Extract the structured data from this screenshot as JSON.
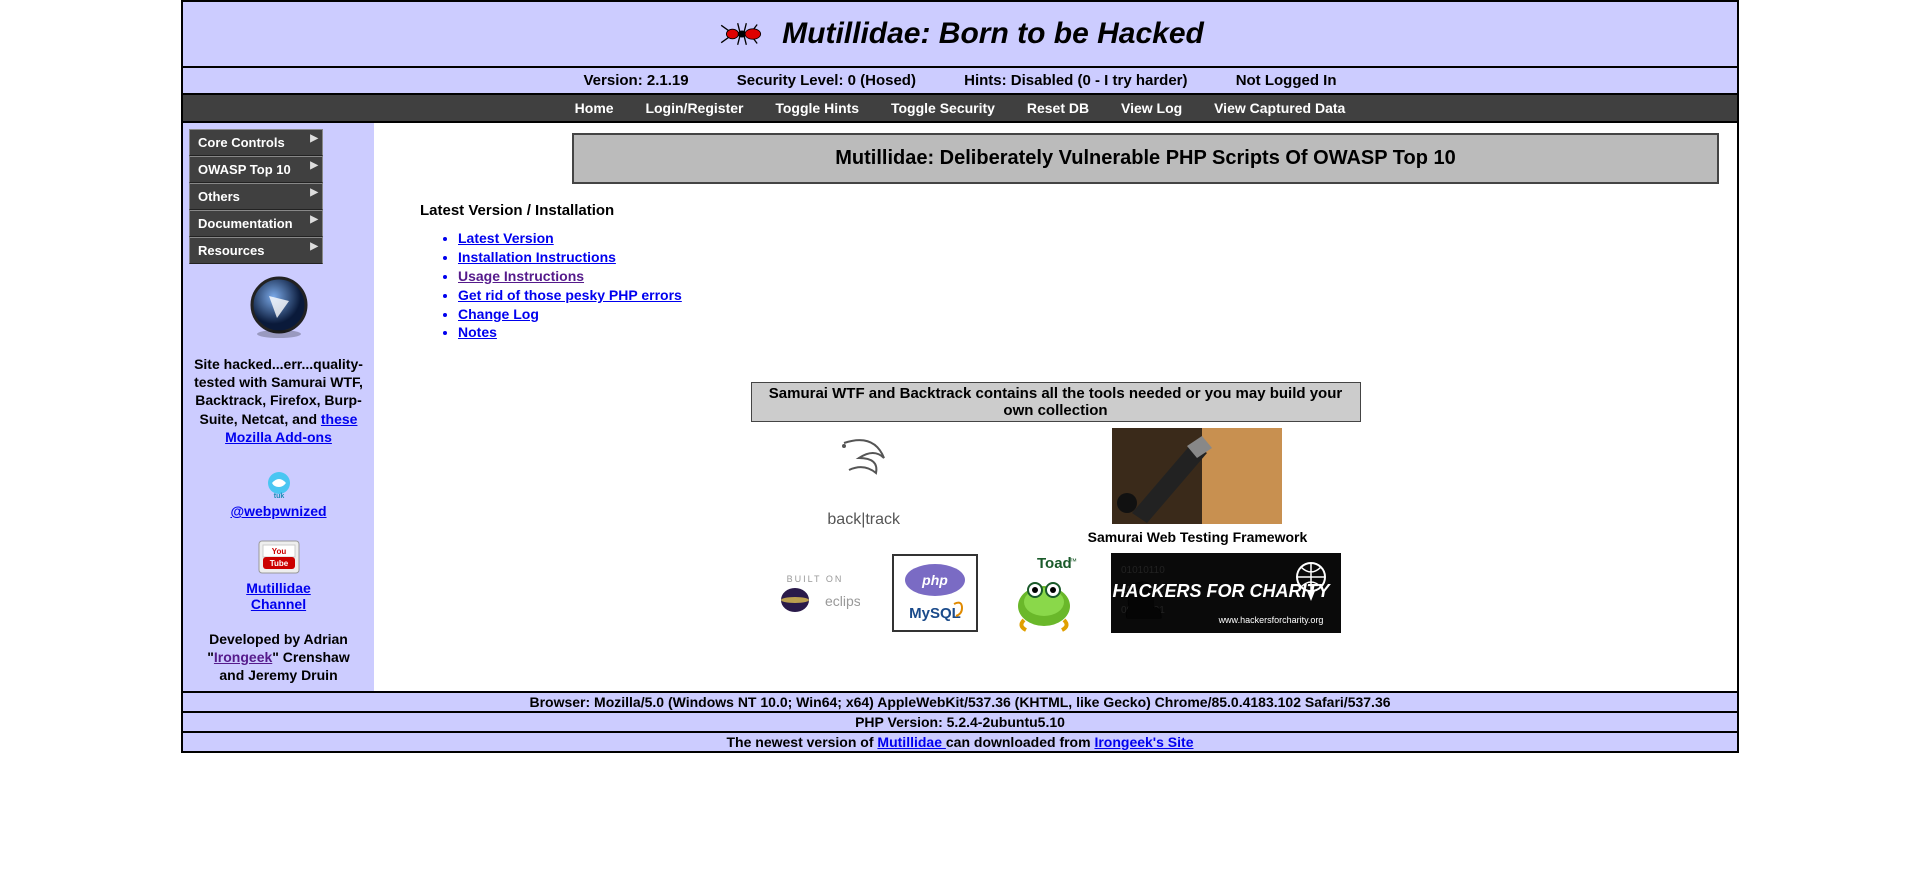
{
  "header": {
    "title": "Mutillidae: Born to be Hacked"
  },
  "status": {
    "version": "Version: 2.1.19",
    "security": "Security Level: 0 (Hosed)",
    "hints": "Hints: Disabled (0 - I try harder)",
    "login": "Not Logged In"
  },
  "nav": {
    "home": "Home",
    "login": "Login/Register",
    "hints": "Toggle Hints",
    "security": "Toggle Security",
    "reset": "Reset DB",
    "log": "View Log",
    "captured": "View Captured Data"
  },
  "menu": {
    "core": "Core Controls",
    "owasp": "OWASP Top 10",
    "others": "Others",
    "docs": "Documentation",
    "resources": "Resources"
  },
  "sidebar": {
    "tested_pre": "Site hacked...err...quality-tested with Samurai WTF, Backtrack, Firefox, Burp-Suite, Netcat, and ",
    "tested_link": "these Mozilla Add-ons",
    "twitter": "@webpwnized",
    "yt1": "Mutillidae",
    "yt2": "Channel",
    "dev_pre": "Developed by Adrian \"",
    "dev_link": "Irongeek",
    "dev_post": "\" Crenshaw and Jeremy Druin"
  },
  "content": {
    "banner": "Mutillidae: Deliberately Vulnerable PHP Scripts Of OWASP Top 10",
    "section": "Latest Version / Installation",
    "links": {
      "latest": "Latest Version",
      "install": "Installation Instructions",
      "usage": "Usage Instructions",
      "errors": "Get rid of those pesky PHP errors",
      "changelog": "Change Log",
      "notes": "Notes"
    },
    "tools_banner": "Samurai WTF and Backtrack contains all the tools needed or you may build your own collection",
    "backtrack": "back|track",
    "samurai": "Samurai Web Testing Framework",
    "eclipse1": "BUILT ON",
    "eclipse2": "eclipse",
    "hackers": "HACKERS FOR CHARITY",
    "hackers_url": "www.hackersforcharity.org"
  },
  "footer": {
    "browser": "Browser: Mozilla/5.0 (Windows NT 10.0; Win64; x64) AppleWebKit/537.36 (KHTML, like Gecko) Chrome/85.0.4183.102 Safari/537.36",
    "php": "PHP Version: 5.2.4-2ubuntu5.10",
    "newest_pre": "The newest version of ",
    "newest_link1": "Mutillidae ",
    "newest_mid": "can downloaded from ",
    "newest_link2": "Irongeek's Site"
  }
}
